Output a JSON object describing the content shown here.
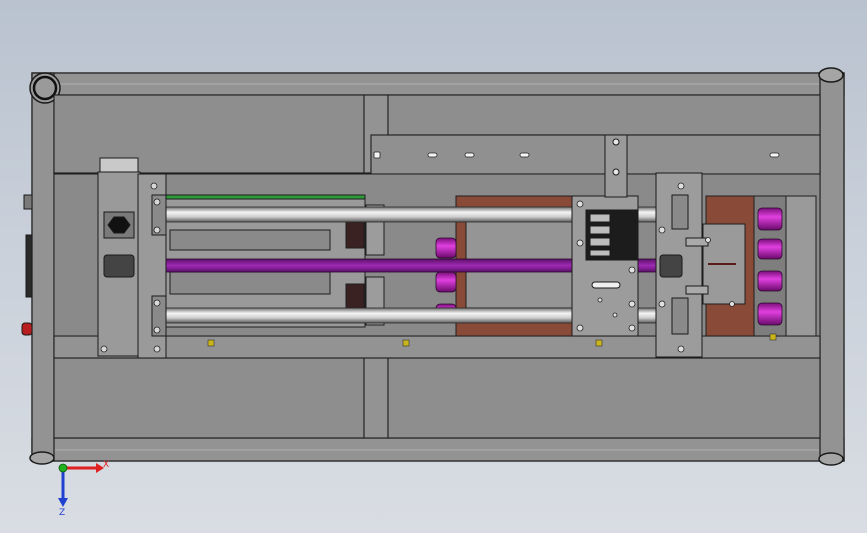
{
  "viewport": {
    "background_top": "#b9c2cf",
    "background_bottom": "#d9dde3"
  },
  "colors": {
    "frame_fill": "#8c8c8c",
    "frame_edge": "#1e1e1e",
    "rail_highlight": "#f2f2f2",
    "belt": "#8a1a9a",
    "magenta_part": "#c01fbf",
    "copper_plate": "#8a4a38",
    "green_strip": "#2f9a3a",
    "yellow_mark": "#c9b41a",
    "red_button": "#b81e1e"
  },
  "triad": {
    "x_label": "X",
    "z_label": "Z",
    "x_color": "#e02020",
    "y_color": "#20b020",
    "z_color": "#2040d0"
  }
}
